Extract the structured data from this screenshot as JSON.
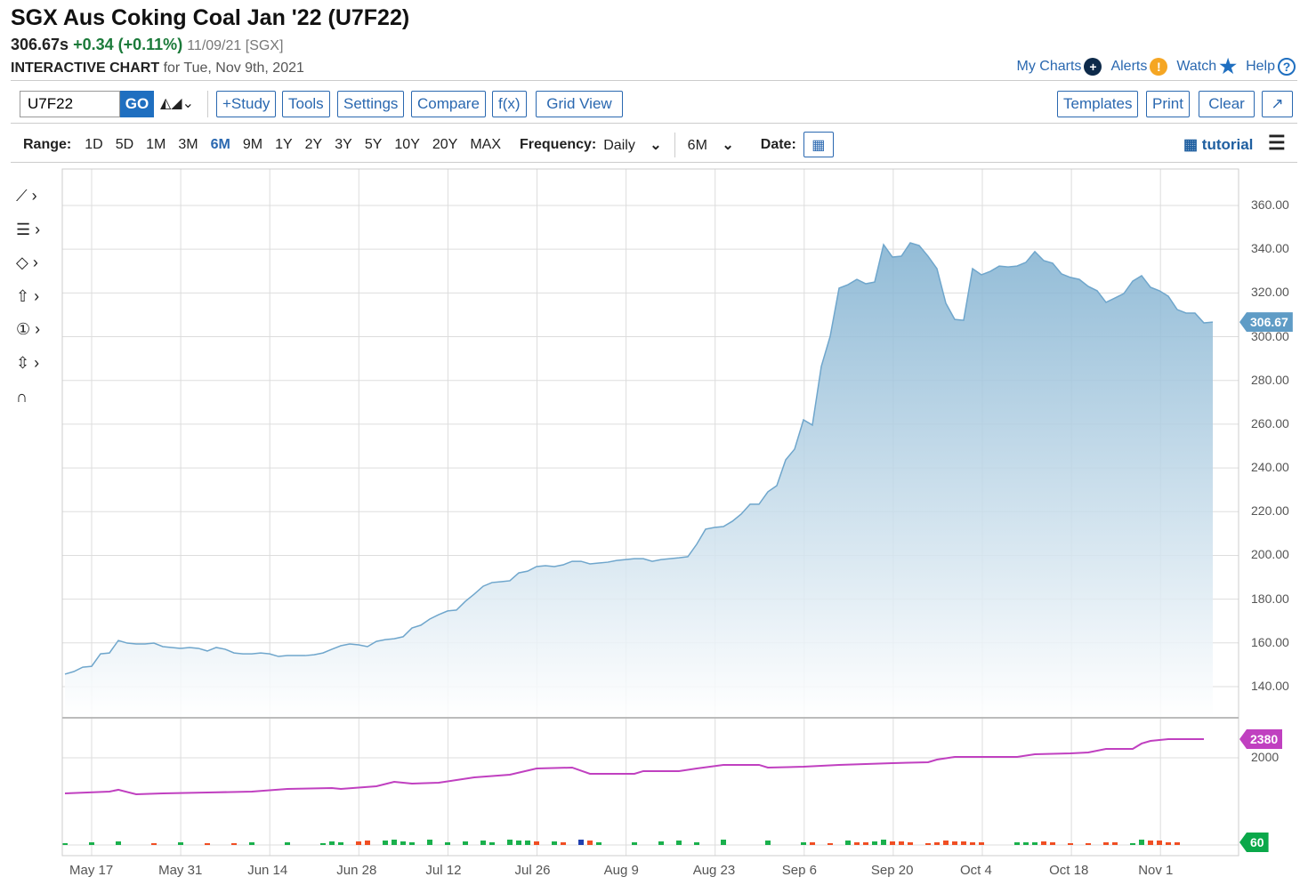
{
  "header": {
    "title": "SGX Aus Coking Coal Jan '22 (U7F22)",
    "last": "306.67s",
    "change": "+0.34 (+0.11%)",
    "date": "11/09/21 [SGX]",
    "sub_bold": "INTERACTIVE CHART",
    "sub_rest": "for Tue, Nov 9th, 2021"
  },
  "links": [
    {
      "label": "My Charts",
      "icon": "plus-circle-icon",
      "glyph": "+",
      "color": "#0d2a4a"
    },
    {
      "label": "Alerts",
      "icon": "alert-icon",
      "glyph": "!",
      "color": "#f5a623"
    },
    {
      "label": "Watch",
      "icon": "star-icon",
      "glyph": "★",
      "color": "#1f6fc0"
    },
    {
      "label": "Help",
      "icon": "help-icon",
      "glyph": "?",
      "color": "#1f6fc0"
    }
  ],
  "toolbar": {
    "symbol": "U7F22",
    "go": "GO",
    "study": "+Study",
    "tools": "Tools",
    "settings": "Settings",
    "compare": "Compare",
    "fx": "f(x)",
    "grid": "Grid View",
    "templates": "Templates",
    "print": "Print",
    "clear": "Clear",
    "expand": "↗"
  },
  "range": {
    "label": "Range:",
    "options": [
      "1D",
      "5D",
      "1M",
      "3M",
      "6M",
      "9M",
      "1Y",
      "2Y",
      "3Y",
      "5Y",
      "10Y",
      "20Y",
      "MAX"
    ],
    "active": "6M",
    "freq_label": "Frequency:",
    "freq": "Daily",
    "period": "6M",
    "date_label": "Date:",
    "tutorial": "tutorial"
  },
  "colors": {
    "accent": "#2a68b0",
    "area": "#7fb0d0",
    "oi": "#c040c0",
    "up": "#1ab04c",
    "down": "#f04e23",
    "neutral": "#2040b0"
  },
  "chart_data": {
    "type": "area",
    "title": "SGX Aus Coking Coal Jan '22 (U7F22)",
    "x_start": "May 12, 2021",
    "x_end": "Nov 9, 2021",
    "x_ticks": [
      "May 17",
      "May 31",
      "Jun 14",
      "Jun 28",
      "Jul 12",
      "Jul 26",
      "Aug 9",
      "Aug 23",
      "Sep 6",
      "Sep 20",
      "Oct 4",
      "Oct 18",
      "Nov 1"
    ],
    "y_ticks": [
      "360.00",
      "340.00",
      "320.00",
      "300.00",
      "280.00",
      "260.00",
      "240.00",
      "220.00",
      "200.00",
      "180.00",
      "160.00",
      "140.00"
    ],
    "ylim": [
      135,
      370
    ],
    "last_price": "306.67",
    "price": [
      145.7,
      146.9,
      148.9,
      149.3,
      155.0,
      155.4,
      161.1,
      159.9,
      159.5,
      159.5,
      159.9,
      158.3,
      157.9,
      157.5,
      157.9,
      157.5,
      156.3,
      157.9,
      157.1,
      155.4,
      155.0,
      155.0,
      155.4,
      155.0,
      153.8,
      154.2,
      154.2,
      154.2,
      154.6,
      155.4,
      157.1,
      158.7,
      159.5,
      159.1,
      158.3,
      160.7,
      161.5,
      161.9,
      162.8,
      166.8,
      168.1,
      170.9,
      172.9,
      174.6,
      175.0,
      179.0,
      182.3,
      185.9,
      187.6,
      188.0,
      188.4,
      192.0,
      192.8,
      194.9,
      195.3,
      194.9,
      195.7,
      197.3,
      197.3,
      196.1,
      196.5,
      196.9,
      197.7,
      198.1,
      198.5,
      198.5,
      197.3,
      198.1,
      198.5,
      198.9,
      199.4,
      205.1,
      212.0,
      212.8,
      213.2,
      215.6,
      218.9,
      223.4,
      223.4,
      229.1,
      231.9,
      243.7,
      248.6,
      262.0,
      259.6,
      286.4,
      300.2,
      322.2,
      323.8,
      326.2,
      324.2,
      325.0,
      342.1,
      336.4,
      336.8,
      342.9,
      341.7,
      336.8,
      331.1,
      315.3,
      307.9,
      307.5,
      331.1,
      328.3,
      329.9,
      332.3,
      331.9,
      332.3,
      334.0,
      338.9,
      334.8,
      333.6,
      328.7,
      327.1,
      326.2,
      323.0,
      321.0,
      315.7,
      317.7,
      319.7,
      325.4,
      327.9,
      322.6,
      321.0,
      318.5,
      312.4,
      310.8,
      310.8,
      306.3,
      306.67
    ],
    "open_interest": {
      "tick": "2000",
      "last": "2380",
      "points": [
        [
          0,
          1276
        ],
        [
          5,
          1312
        ],
        [
          6,
          1349
        ],
        [
          8,
          1258
        ],
        [
          11,
          1276
        ],
        [
          16,
          1294
        ],
        [
          21,
          1312
        ],
        [
          25,
          1367
        ],
        [
          30,
          1385
        ],
        [
          31,
          1367
        ],
        [
          35,
          1421
        ],
        [
          37,
          1511
        ],
        [
          39,
          1475
        ],
        [
          42,
          1493
        ],
        [
          44,
          1548
        ],
        [
          46,
          1602
        ],
        [
          50,
          1656
        ],
        [
          53,
          1783
        ],
        [
          57,
          1801
        ],
        [
          59,
          1674
        ],
        [
          64,
          1674
        ],
        [
          65,
          1729
        ],
        [
          69,
          1729
        ],
        [
          71,
          1783
        ],
        [
          74,
          1856
        ],
        [
          78,
          1856
        ],
        [
          79,
          1801
        ],
        [
          83,
          1819
        ],
        [
          87,
          1856
        ],
        [
          93,
          1892
        ],
        [
          97,
          1910
        ],
        [
          98,
          1964
        ],
        [
          100,
          2018
        ],
        [
          107,
          2018
        ],
        [
          109,
          2073
        ],
        [
          113,
          2091
        ],
        [
          115,
          2109
        ],
        [
          117,
          2181
        ],
        [
          120,
          2181
        ],
        [
          121,
          2290
        ],
        [
          122,
          2344
        ],
        [
          124,
          2380
        ],
        [
          128,
          2380
        ]
      ]
    },
    "volume": {
      "last": "60",
      "bars": [
        [
          0,
          20,
          "u"
        ],
        [
          3,
          30,
          "u"
        ],
        [
          6,
          40,
          "u"
        ],
        [
          10,
          20,
          "d"
        ],
        [
          13,
          30,
          "u"
        ],
        [
          16,
          20,
          "d"
        ],
        [
          19,
          20,
          "d"
        ],
        [
          21,
          30,
          "u"
        ],
        [
          25,
          30,
          "u"
        ],
        [
          29,
          20,
          "u"
        ],
        [
          30,
          40,
          "u"
        ],
        [
          31,
          30,
          "u"
        ],
        [
          33,
          40,
          "d"
        ],
        [
          34,
          50,
          "d"
        ],
        [
          36,
          50,
          "u"
        ],
        [
          37,
          60,
          "u"
        ],
        [
          38,
          40,
          "u"
        ],
        [
          39,
          30,
          "u"
        ],
        [
          41,
          60,
          "u"
        ],
        [
          43,
          30,
          "u"
        ],
        [
          45,
          40,
          "u"
        ],
        [
          47,
          50,
          "u"
        ],
        [
          48,
          30,
          "u"
        ],
        [
          50,
          60,
          "u"
        ],
        [
          51,
          50,
          "u"
        ],
        [
          52,
          50,
          "u"
        ],
        [
          53,
          40,
          "d"
        ],
        [
          55,
          40,
          "u"
        ],
        [
          56,
          30,
          "d"
        ],
        [
          58,
          60,
          "n"
        ],
        [
          59,
          50,
          "d"
        ],
        [
          60,
          30,
          "u"
        ],
        [
          64,
          30,
          "u"
        ],
        [
          67,
          40,
          "u"
        ],
        [
          69,
          50,
          "u"
        ],
        [
          71,
          30,
          "u"
        ],
        [
          74,
          60,
          "u"
        ],
        [
          79,
          50,
          "u"
        ],
        [
          83,
          30,
          "u"
        ],
        [
          84,
          30,
          "d"
        ],
        [
          86,
          20,
          "d"
        ],
        [
          88,
          50,
          "u"
        ],
        [
          89,
          30,
          "d"
        ],
        [
          90,
          30,
          "d"
        ],
        [
          91,
          40,
          "u"
        ],
        [
          92,
          60,
          "u"
        ],
        [
          93,
          40,
          "d"
        ],
        [
          94,
          40,
          "d"
        ],
        [
          95,
          30,
          "d"
        ],
        [
          97,
          20,
          "d"
        ],
        [
          98,
          30,
          "d"
        ],
        [
          99,
          50,
          "d"
        ],
        [
          100,
          40,
          "d"
        ],
        [
          101,
          40,
          "d"
        ],
        [
          102,
          30,
          "d"
        ],
        [
          103,
          30,
          "d"
        ],
        [
          107,
          30,
          "u"
        ],
        [
          108,
          30,
          "u"
        ],
        [
          109,
          30,
          "u"
        ],
        [
          110,
          40,
          "d"
        ],
        [
          111,
          30,
          "d"
        ],
        [
          113,
          20,
          "d"
        ],
        [
          115,
          20,
          "d"
        ],
        [
          117,
          30,
          "d"
        ],
        [
          118,
          30,
          "d"
        ],
        [
          120,
          20,
          "u"
        ],
        [
          121,
          60,
          "u"
        ],
        [
          122,
          50,
          "d"
        ],
        [
          123,
          50,
          "d"
        ],
        [
          124,
          30,
          "d"
        ],
        [
          125,
          30,
          "d"
        ]
      ]
    }
  }
}
